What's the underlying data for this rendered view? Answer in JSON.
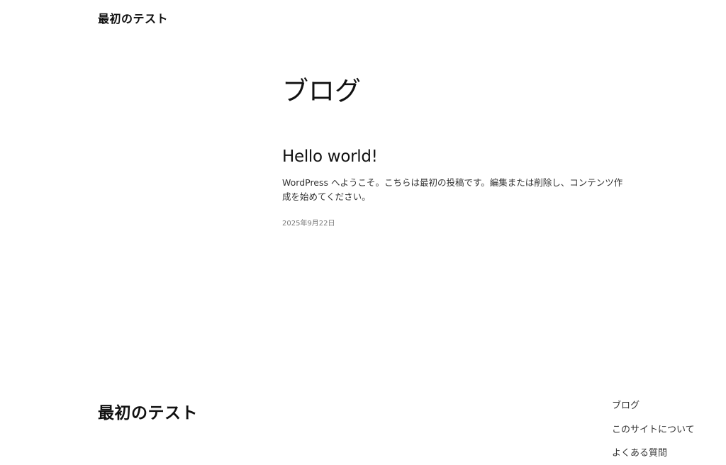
{
  "header": {
    "site_title": "最初のテスト"
  },
  "main": {
    "page_heading": "ブログ",
    "posts": [
      {
        "title": "Hello world!",
        "excerpt": "WordPress へようこそ。こちらは最初の投稿です。編集または削除し、コンテンツ作成を始めてください。",
        "date": "2025年9月22日"
      }
    ]
  },
  "footer": {
    "site_title": "最初のテスト",
    "nav": [
      {
        "label": "ブログ"
      },
      {
        "label": "このサイトについて"
      },
      {
        "label": "よくある質問"
      }
    ]
  }
}
